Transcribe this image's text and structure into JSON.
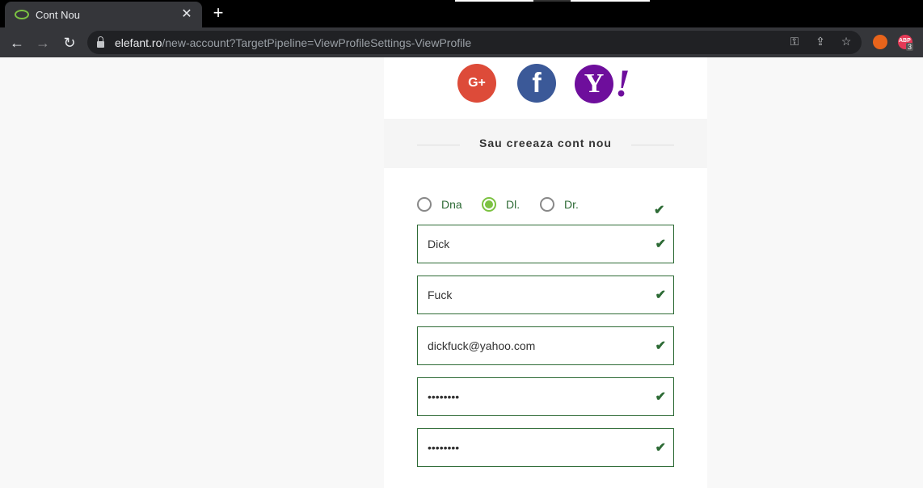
{
  "browser": {
    "tab_title": "Cont Nou",
    "tab_close": "✕",
    "new_tab": "+",
    "url_host": "elefant.ro",
    "url_path": "/new-account?TargetPipeline=ViewProfileSettings-ViewProfile",
    "ext_badge": "3",
    "ext_label": "ABP"
  },
  "social": {
    "google_label": "G+",
    "facebook_label": "f",
    "yahoo_label": "Y",
    "yahoo_bang": "!"
  },
  "divider_text": "Sau creeaza cont nou",
  "title_options": [
    {
      "label": "Dna",
      "checked": false
    },
    {
      "label": "Dl.",
      "checked": true
    },
    {
      "label": "Dr.",
      "checked": false
    }
  ],
  "fields": {
    "first_name": "Dick",
    "last_name": "Fuck",
    "email": "dickfuck@yahoo.com",
    "password": "••••••••",
    "password_confirm": "••••••••"
  },
  "check_glyph": "✔",
  "colors": {
    "accent_green": "#7cc242",
    "valid_green": "#2e6b36",
    "google": "#dd4b39",
    "facebook": "#3b5998",
    "yahoo": "#6e0e9c"
  }
}
